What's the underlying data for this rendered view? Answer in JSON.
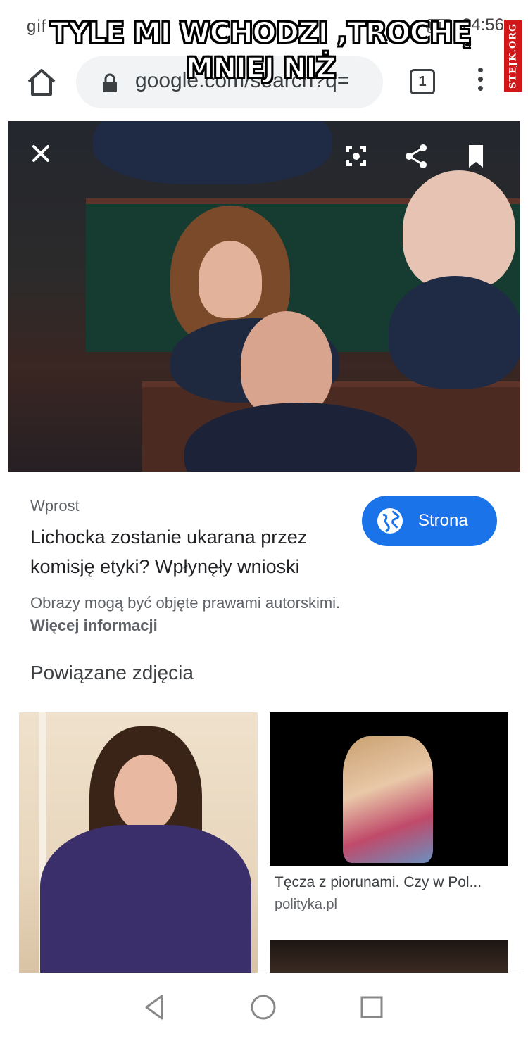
{
  "status_bar": {
    "left_text": "gif",
    "time": "24:56"
  },
  "meme": {
    "caption": "TYLE MI WCHODZI ,TROCHĘ MNIEJ NIŻ",
    "watermark": "STEJK.ORG"
  },
  "browser": {
    "url": "google.com/search?q=",
    "tab_count": "1"
  },
  "icons": {
    "home": "home-icon",
    "lock": "lock-icon",
    "menu": "more-vert-icon",
    "close": "close-icon",
    "lens": "lens-icon",
    "share": "share-icon",
    "bookmark": "bookmark-icon",
    "globe": "globe-icon",
    "back": "back-icon",
    "home_nav": "home-circle-icon",
    "recents": "recents-icon"
  },
  "result": {
    "source": "Wprost",
    "title": "Lichocka zostanie ukarana przez komisję etyki? Wpłynęły wnioski",
    "visit_button": "Strona",
    "copyright_notice": "Obrazy mogą być objęte prawami autorskimi.",
    "more_info": "Więcej informacji"
  },
  "related": {
    "heading": "Powiązane zdjęcia",
    "items": [
      {
        "caption": "Tęcza z piorunami. Czy w Pol...",
        "domain": "polityka.pl"
      }
    ]
  },
  "colors": {
    "accent": "#1a73e8",
    "watermark_bg": "#d11717"
  }
}
